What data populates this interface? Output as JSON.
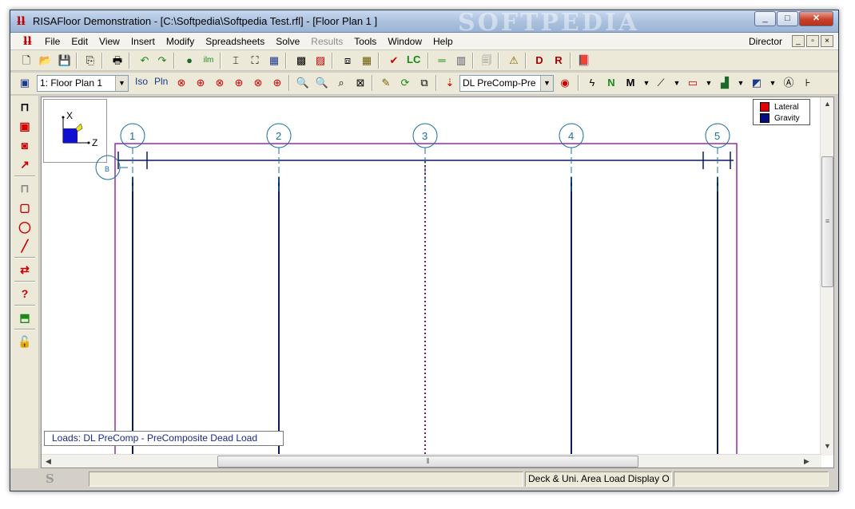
{
  "window": {
    "title": "RISAFloor Demonstration - [C:\\Softpedia\\Softpedia Test.rfl] - [Floor Plan 1          ]",
    "watermark": "SOFTPEDIA",
    "minimize": "_",
    "maximize": "□",
    "close": "✕"
  },
  "menubar": {
    "items": [
      {
        "label": "File",
        "enabled": true
      },
      {
        "label": "Edit",
        "enabled": true
      },
      {
        "label": "View",
        "enabled": true
      },
      {
        "label": "Insert",
        "enabled": true
      },
      {
        "label": "Modify",
        "enabled": true
      },
      {
        "label": "Spreadsheets",
        "enabled": true
      },
      {
        "label": "Solve",
        "enabled": true
      },
      {
        "label": "Results",
        "enabled": false
      },
      {
        "label": "Tools",
        "enabled": true
      },
      {
        "label": "Window",
        "enabled": true
      },
      {
        "label": "Help",
        "enabled": true
      }
    ],
    "user": "Director",
    "mdi_min": "_",
    "mdi_restore": "▫",
    "mdi_close": "×"
  },
  "toolbar1": {
    "lc_label": "LC"
  },
  "toolbar2": {
    "floor_select": "1: Floor Plan 1",
    "iso_label": "Iso",
    "pln_label": "Pln",
    "load_case_select": "DL PreComp-Pre"
  },
  "canvas": {
    "legend": [
      {
        "label": "Lateral",
        "color": "#e00000"
      },
      {
        "label": "Gravity",
        "color": "#001080"
      }
    ],
    "axis": {
      "x_label": "X",
      "z_label": "Z"
    },
    "grid_labels": [
      "1",
      "2",
      "3",
      "4",
      "5"
    ],
    "letter_grid_label": "B",
    "load_status": "Loads: DL PreComp - PreComposite Dead Load",
    "colors": {
      "grid": "#1a6fa0",
      "beam": "#0b1a5c",
      "outline": "#9a2aa8",
      "dashed_beam": "#7a1070"
    }
  },
  "statusbar": {
    "logo": "S",
    "message": "Deck & Uni. Area Load Display O"
  }
}
